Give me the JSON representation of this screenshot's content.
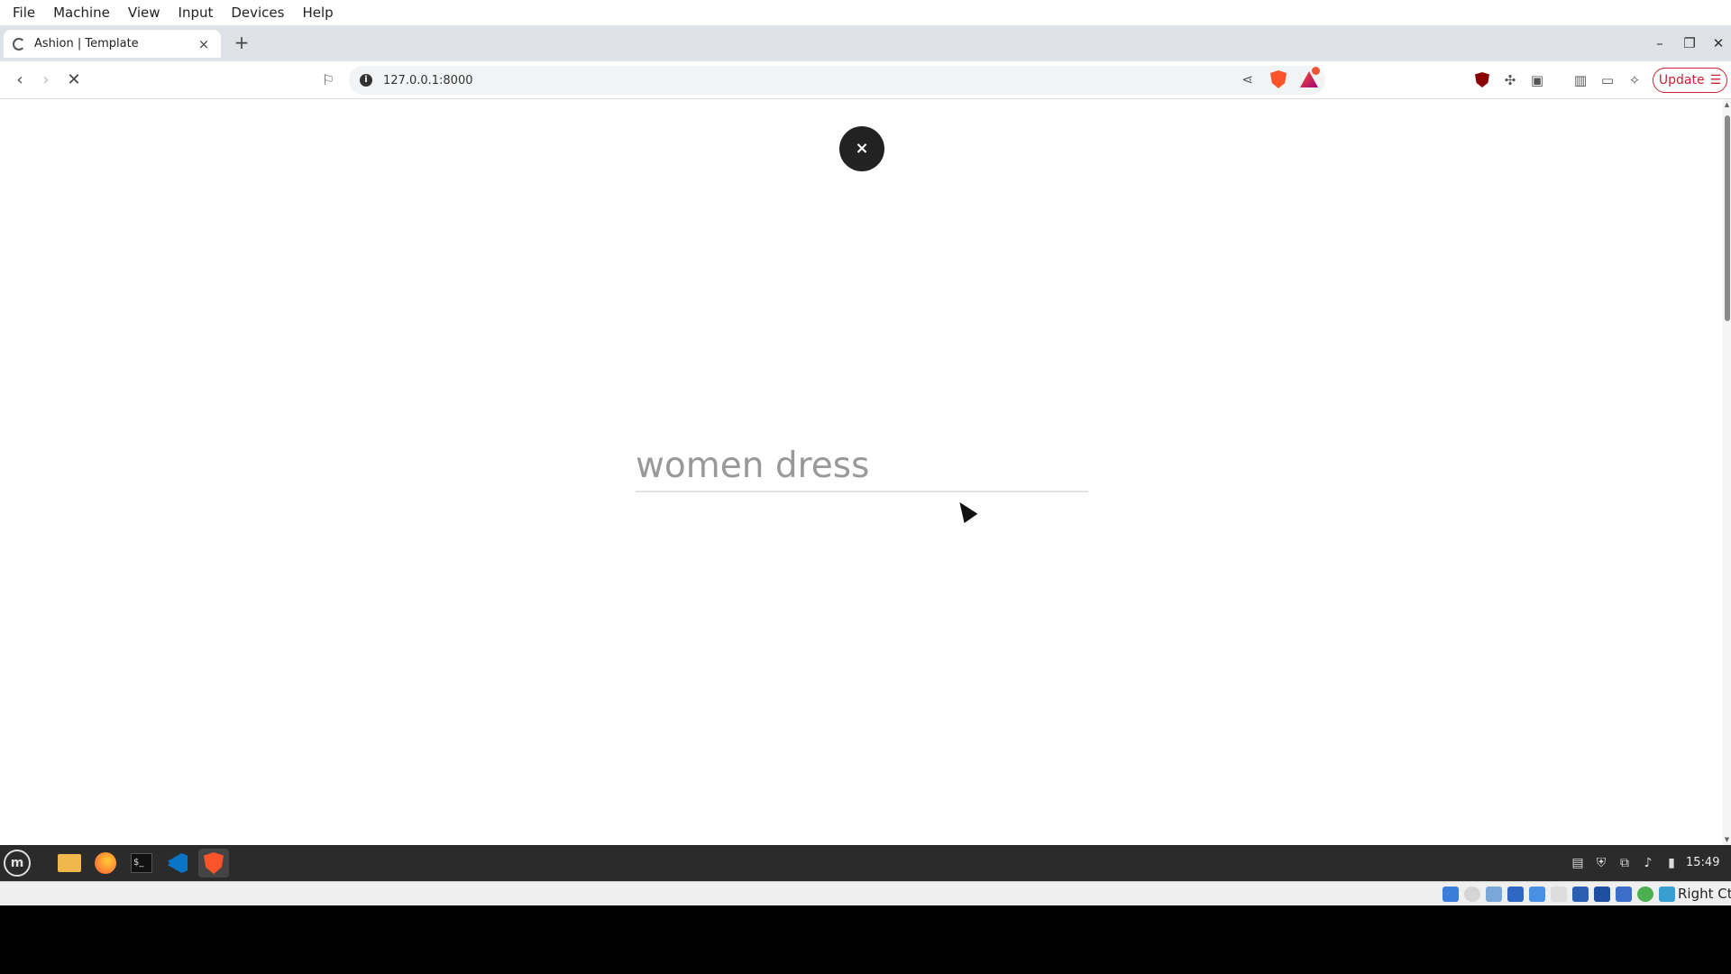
{
  "vm_menu": [
    "File",
    "Machine",
    "View",
    "Input",
    "Devices",
    "Help"
  ],
  "browser": {
    "tab_title": "Ashion | Template",
    "tab_close": "×",
    "new_tab": "+",
    "url": "127.0.0.1:8000",
    "update_label": "Update",
    "window_controls": {
      "minimize": "–",
      "restore": "❐",
      "close": "✕"
    }
  },
  "page": {
    "close_label": "×",
    "search_value": "women dress",
    "search_placeholder": "women dress"
  },
  "taskbar": {
    "clock": "15:49",
    "apps": [
      "menu-icon",
      "files-icon",
      "firefox-icon",
      "terminal-icon",
      "vscode-icon",
      "brave-icon"
    ]
  },
  "vm_status": {
    "host_key": "Right Ctrl"
  },
  "colors": {
    "close_button": "#222222",
    "search_text": "#999999",
    "update_accent": "#cc2233",
    "taskbar": "#2b2b2b"
  }
}
